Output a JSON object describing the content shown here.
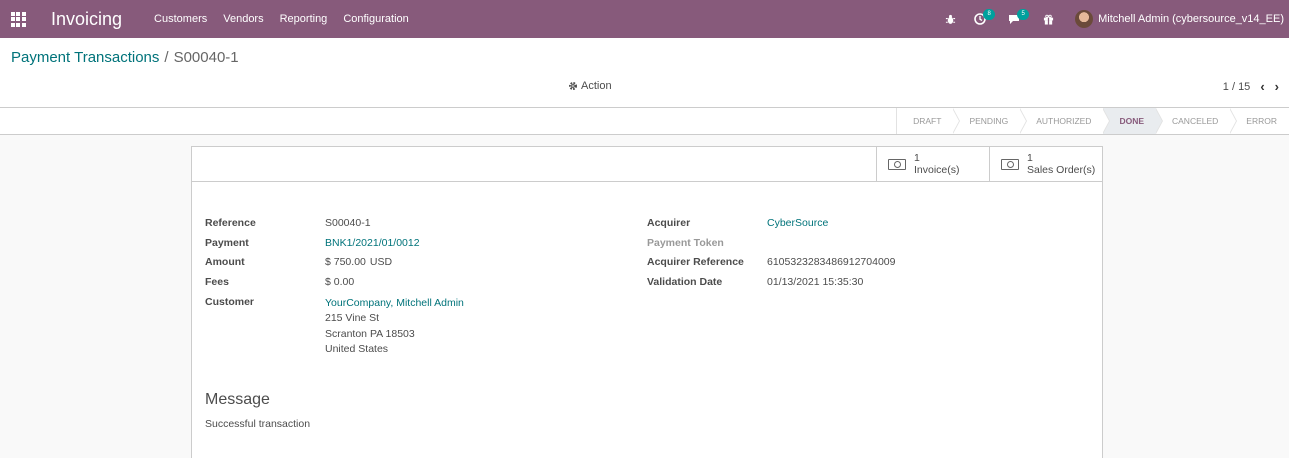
{
  "navbar": {
    "app_name": "Invoicing",
    "menu": [
      "Customers",
      "Vendors",
      "Reporting",
      "Configuration"
    ],
    "activity_count": "8",
    "message_count": "5",
    "user_name": "Mitchell Admin (cybersource_v14_EE)"
  },
  "breadcrumb": {
    "parent": "Payment Transactions",
    "separator": "/",
    "current": "S00040-1"
  },
  "toolbar": {
    "action_label": "Action",
    "pager": "1 / 15"
  },
  "statusbar": {
    "stages": [
      "DRAFT",
      "PENDING",
      "AUTHORIZED",
      "DONE",
      "CANCELED",
      "ERROR"
    ],
    "active": "DONE"
  },
  "smart_buttons": [
    {
      "count": "1",
      "label": "Invoice(s)"
    },
    {
      "count": "1",
      "label": "Sales Order(s)"
    }
  ],
  "form": {
    "left": {
      "reference_label": "Reference",
      "reference_value": "S00040-1",
      "payment_label": "Payment",
      "payment_value": "BNK1/2021/01/0012",
      "amount_label": "Amount",
      "amount_value": "$ 750.00",
      "amount_currency": "USD",
      "fees_label": "Fees",
      "fees_value": "$ 0.00",
      "customer_label": "Customer",
      "customer_name": "YourCompany, Mitchell Admin",
      "customer_address": [
        "215 Vine St",
        "Scranton PA 18503",
        "United States"
      ]
    },
    "right": {
      "acquirer_label": "Acquirer",
      "acquirer_value": "CyberSource",
      "token_label": "Payment Token",
      "acq_ref_label": "Acquirer Reference",
      "acq_ref_value": "6105323283486912704009",
      "validation_label": "Validation Date",
      "validation_value": "01/13/2021 15:35:30"
    },
    "message_title": "Message",
    "message_text": "Successful transaction"
  },
  "colors": {
    "brand": "#875a7b",
    "link": "#00737a",
    "badge": "#00a09d"
  }
}
